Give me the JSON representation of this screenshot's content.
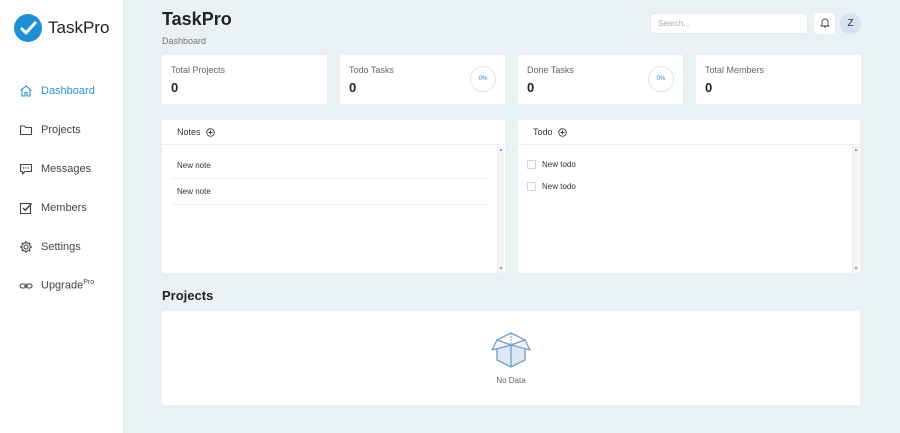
{
  "brand": {
    "name": "TaskPro"
  },
  "sidebar": {
    "items": [
      {
        "label": "Dashboard",
        "icon": "home-icon",
        "active": true
      },
      {
        "label": "Projects",
        "icon": "folder-icon"
      },
      {
        "label": "Messages",
        "icon": "message-icon"
      },
      {
        "label": "Members",
        "icon": "check-square-icon"
      },
      {
        "label": "Settings",
        "icon": "gear-icon"
      },
      {
        "label": "Upgrade",
        "icon": "link-icon",
        "badge": "Pro"
      }
    ]
  },
  "header": {
    "title": "TaskPro",
    "breadcrumb": "Dashboard",
    "search_placeholder": "Search...",
    "avatar_initial": "Z"
  },
  "stats": [
    {
      "label": "Total Projects",
      "value": "0"
    },
    {
      "label": "Todo Tasks",
      "value": "0",
      "percent": "0%"
    },
    {
      "label": "Done Tasks",
      "value": "0",
      "percent": "0%"
    },
    {
      "label": "Total Members",
      "value": "0"
    }
  ],
  "notes": {
    "title": "Notes",
    "items": [
      "New note",
      "New note"
    ]
  },
  "todo": {
    "title": "Todo",
    "items": [
      "New todo",
      "New todo"
    ]
  },
  "projects": {
    "title": "Projects",
    "empty_text": "No Data"
  },
  "colors": {
    "accent": "#1e8fd6",
    "background": "#eaf1f4",
    "active_text": "#2c8fd0"
  }
}
